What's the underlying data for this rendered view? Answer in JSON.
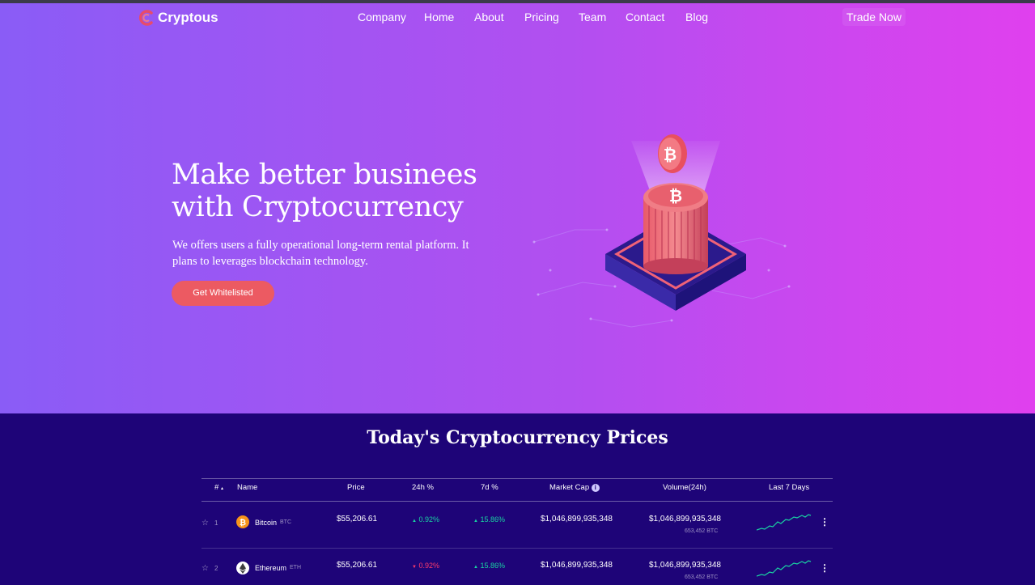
{
  "brand": {
    "name": "Cryptous"
  },
  "nav": {
    "items": [
      "Company",
      "Home",
      "About",
      "Pricing",
      "Team",
      "Contact",
      "Blog"
    ],
    "trade_button": "Trade Now"
  },
  "hero": {
    "title": "Make better businees with Cryptocurrency",
    "description": "We offers users a fully operational long-term rental platform. It plans to leverages blockchain technology.",
    "cta": "Get Whitelisted"
  },
  "prices": {
    "title": "Today's Cryptocurrency Prices",
    "headers": {
      "rank": "#",
      "name": "Name",
      "price": "Price",
      "change_24h": "24h %",
      "change_7d": "7d %",
      "market_cap": "Market Cap",
      "volume": "Volume(24h)",
      "last_7_days": "Last 7 Days"
    },
    "rows": [
      {
        "rank": "1",
        "name": "Bitcoin",
        "symbol": "BTC",
        "price": "$55,206.61",
        "change_24h": "0.92%",
        "change_24h_direction": "up",
        "change_7d": "15.86%",
        "change_7d_direction": "up",
        "market_cap": "$1,046,899,935,348",
        "volume": "$1,046,899,935,348",
        "volume_btc": "653,452 BTC",
        "icon": "bitcoin-icon",
        "icon_color": "#f7931a"
      },
      {
        "rank": "2",
        "name": "Ethereum",
        "symbol": "ETH",
        "price": "$55,206.61",
        "change_24h": "0.92%",
        "change_24h_direction": "down",
        "change_7d": "15.86%",
        "change_7d_direction": "up",
        "market_cap": "$1,046,899,935,348",
        "volume": "$1,046,899,935,348",
        "volume_btc": "653,452 BTC",
        "icon": "ethereum-icon",
        "icon_color": "#ffffff"
      }
    ]
  },
  "colors": {
    "hero_start": "#8a5cf6",
    "hero_end": "#e040ee",
    "section_bg": "#1e0478",
    "cta": "#ec5a62",
    "positive": "#19d3a2",
    "negative": "#ff3b6b"
  }
}
